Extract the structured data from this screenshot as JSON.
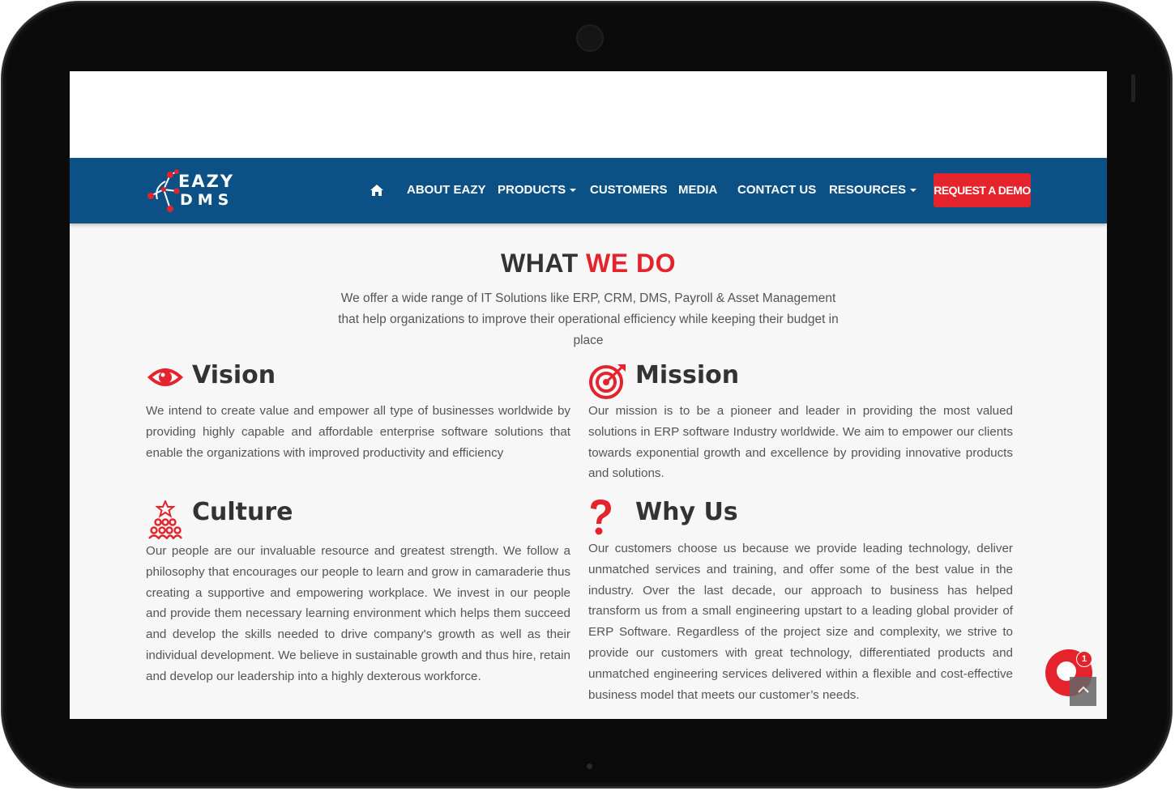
{
  "brand": {
    "logo_line1": "EAZY",
    "logo_line2": "DMS"
  },
  "nav": {
    "home_icon": "home-icon",
    "items": [
      "ABOUT EAZY",
      "PRODUCTS",
      "CUSTOMERS",
      "MEDIA",
      "CONTACT US",
      "RESOURCES"
    ],
    "cta": "REQUEST A DEMO"
  },
  "section": {
    "title_part1": "WHAT",
    "title_part2": "WE DO",
    "intro": "We offer a wide range of IT Solutions like ERP, CRM, DMS, Payroll & Asset Management that help organizations to improve their operational efficiency while keeping their budget in place"
  },
  "blocks": {
    "vision": {
      "heading": "Vision",
      "icon": "eye-icon",
      "text": "We intend to create value and empower all type of businesses worldwide by providing highly capable and affordable enterprise software solutions that enable the organizations with improved productivity and efficiency"
    },
    "mission": {
      "heading": "Mission",
      "icon": "target-icon",
      "text": "Our mission is to be a pioneer and leader in providing the most valued solutions in ERP software Industry worldwide. We aim to empower our clients towards exponential growth and excellence by providing innovative products and solutions."
    },
    "culture": {
      "heading": "Culture",
      "icon": "team-icon",
      "text": "Our people are our invaluable resource and greatest strength. We follow a philosophy that encourages our people to learn and grow in camaraderie thus creating a supportive and empowering workplace. We invest in our people and provide them necessary learning environment which helps them succeed and develop the skills needed to drive company's growth as well as their individual development. We believe in sustainable growth and thus hire, retain and develop our leadership into a highly dexterous workforce."
    },
    "whyus": {
      "heading": "Why Us",
      "icon": "question-icon",
      "text": "Our customers choose us because we provide leading technology, deliver unmatched services and training, and offer some of the best value in the industry. Over the last decade, our approach to business has helped transform us from a small engineering upstart to a leading global provider of ERP Software. Regardless of the project size and complexity, we strive to provide our customers with great technology, differentiated products and unmatched engineering services delivered within a flexible and cost-effective business model that meets our customer’s needs."
    }
  },
  "widgets": {
    "chat_badge": "1",
    "chat_icon": "chat-icon",
    "scroll_icon": "chevron-up-icon"
  },
  "colors": {
    "nav_bg": "#0b5186",
    "accent": "#e5232c",
    "page_bg": "#f7f7f7"
  }
}
